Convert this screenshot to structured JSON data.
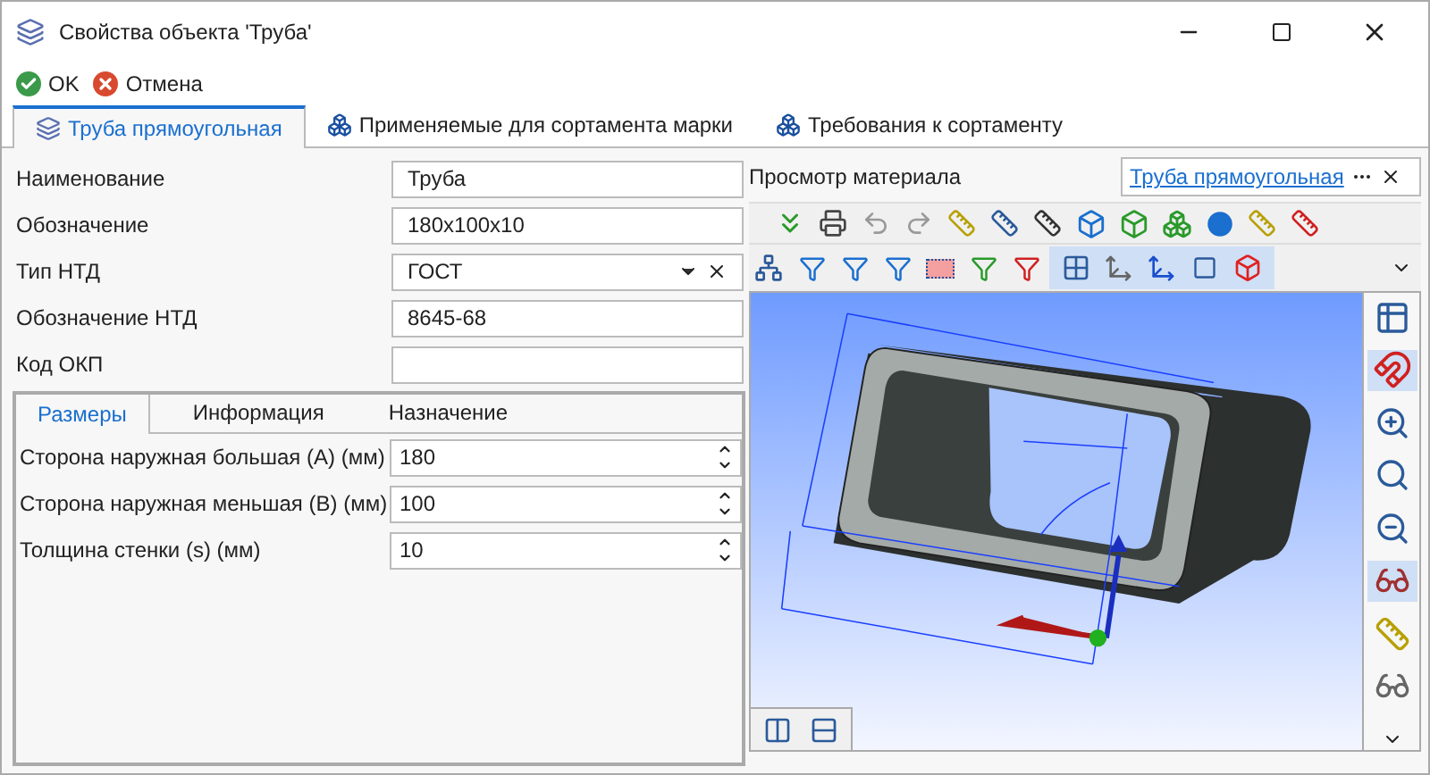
{
  "window": {
    "title": "Свойства объекта 'Труба'"
  },
  "toolbar": [
    {
      "label": "OK",
      "kind": "ok"
    },
    {
      "label": "Отмена",
      "kind": "cancel"
    }
  ],
  "tabs": [
    {
      "label": "Труба прямоугольная",
      "selected": true
    },
    {
      "label": "Применяемые для сортамента марки",
      "selected": false
    },
    {
      "label": "Требования к сортаменту",
      "selected": false
    }
  ],
  "fields": [
    {
      "label": "Наименование",
      "value": "Труба",
      "kind": "text"
    },
    {
      "label": "Обозначение",
      "value": "180x100x10",
      "kind": "text"
    },
    {
      "label": "Тип НТД",
      "value": "ГОСТ",
      "kind": "dropdown"
    },
    {
      "label": "Обозначение НТД",
      "value": "8645-68",
      "kind": "text"
    },
    {
      "label": "Код ОКП",
      "kind": "text"
    }
  ],
  "subtabs": [
    {
      "label": "Размеры",
      "selected": true
    },
    {
      "label": "Информация",
      "selected": false
    },
    {
      "label": "Назначение",
      "selected": false
    }
  ],
  "params": [
    {
      "label": "Сторона наружная большая (А) (мм)",
      "value": "180"
    },
    {
      "label": "Сторона наружная меньшая (В) (мм)",
      "value": "100"
    },
    {
      "label": "Толщина стенки (s) (мм)",
      "value": "10"
    }
  ],
  "preview": {
    "title": "Просмотр материала",
    "link": "Труба прямоугольная"
  },
  "side_tools": [
    {
      "kind": "layout",
      "selected": false
    },
    {
      "kind": "magnet",
      "selected": true
    },
    {
      "kind": "zoom-window",
      "selected": false
    },
    {
      "kind": "zoom-fit",
      "selected": false
    },
    {
      "kind": "zoom-prev",
      "selected": false
    },
    {
      "kind": "glasses-x",
      "selected": true
    },
    {
      "kind": "glasses-tools",
      "selected": false
    },
    {
      "kind": "glasses",
      "selected": false
    }
  ]
}
